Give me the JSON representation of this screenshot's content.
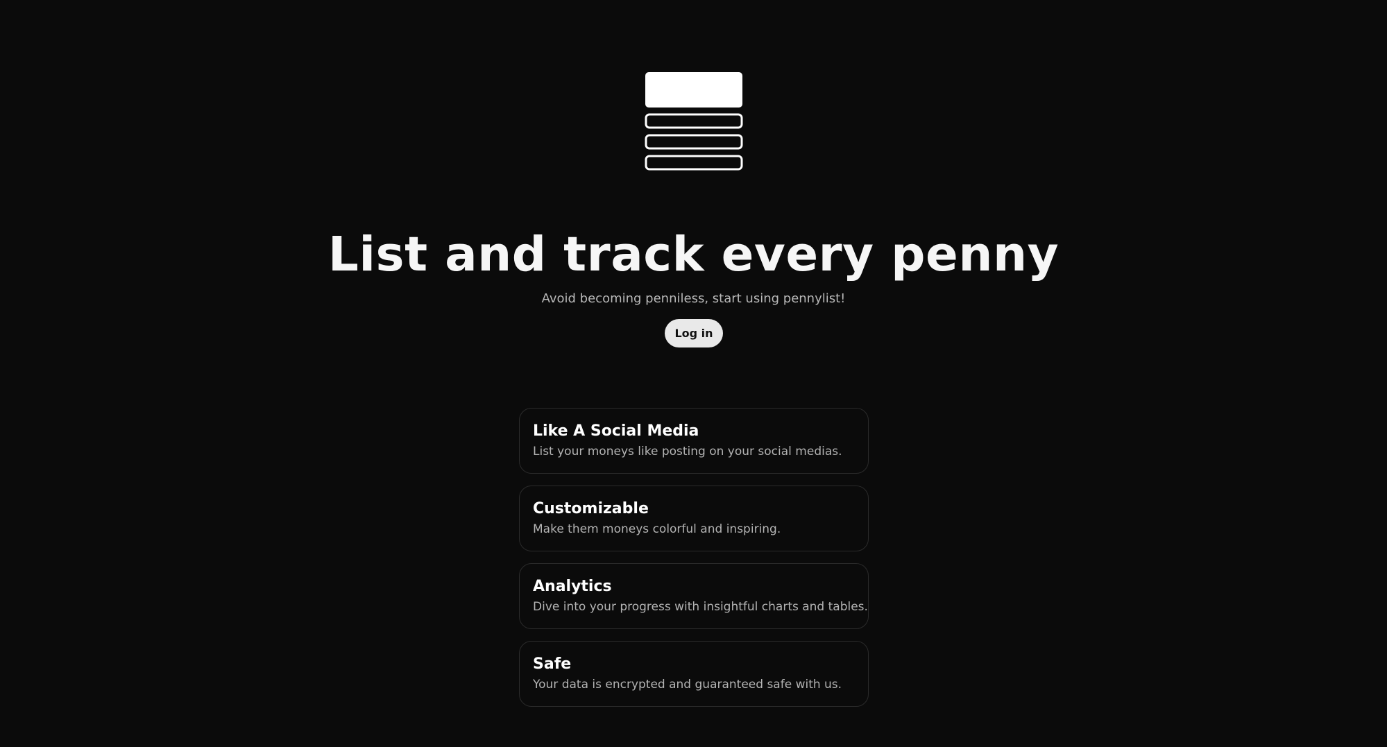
{
  "logo": {
    "icon": "pennylist-stack-logo-icon",
    "color": "#ffffff"
  },
  "hero": {
    "title": "List and track every penny",
    "subtitle": "Avoid becoming penniless, start using pennylist!",
    "login_label": "Log in"
  },
  "features": [
    {
      "title": "Like A Social Media",
      "description": "List your moneys like posting on your social medias."
    },
    {
      "title": "Customizable",
      "description": "Make them moneys colorful and inspiring."
    },
    {
      "title": "Analytics",
      "description": "Dive into your progress with insightful charts and tables."
    },
    {
      "title": "Safe",
      "description": "Your data is encrypted and guaranteed safe with us."
    }
  ],
  "colors": {
    "background": "#0b0b0b",
    "card_border": "#2b2b2b",
    "button_bg": "#e9e9e9",
    "subtitle_text": "#b8b8b8"
  }
}
